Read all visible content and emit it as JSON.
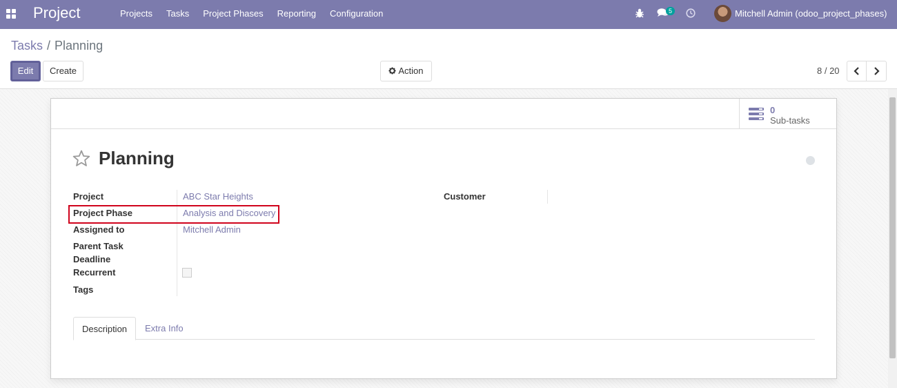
{
  "navbar": {
    "app_title": "Project",
    "menu": [
      "Projects",
      "Tasks",
      "Project Phases",
      "Reporting",
      "Configuration"
    ],
    "chat_badge": "5",
    "user": "Mitchell Admin (odoo_project_phases)"
  },
  "breadcrumb": {
    "parent": "Tasks",
    "separator": "/",
    "current": "Planning"
  },
  "toolbar": {
    "edit_label": "Edit",
    "create_label": "Create",
    "action_label": "Action"
  },
  "pager": {
    "value": "8 / 20"
  },
  "subtasks": {
    "count": "0",
    "label": "Sub-tasks"
  },
  "task": {
    "title": "Planning",
    "fields": {
      "project_label": "Project",
      "project_value": "ABC Star Heights",
      "phase_label": "Project Phase",
      "phase_value": "Analysis and Discovery",
      "assigned_label": "Assigned to",
      "assigned_value": "Mitchell Admin",
      "parent_label": "Parent Task",
      "deadline_label": "Deadline",
      "recurrent_label": "Recurrent",
      "recurrent_checked": false,
      "tags_label": "Tags",
      "customer_label": "Customer"
    }
  },
  "tabs": [
    "Description",
    "Extra Info"
  ],
  "colors": {
    "primary": "#7c7bad",
    "highlight": "#d0021b",
    "badge": "#00a09d"
  }
}
